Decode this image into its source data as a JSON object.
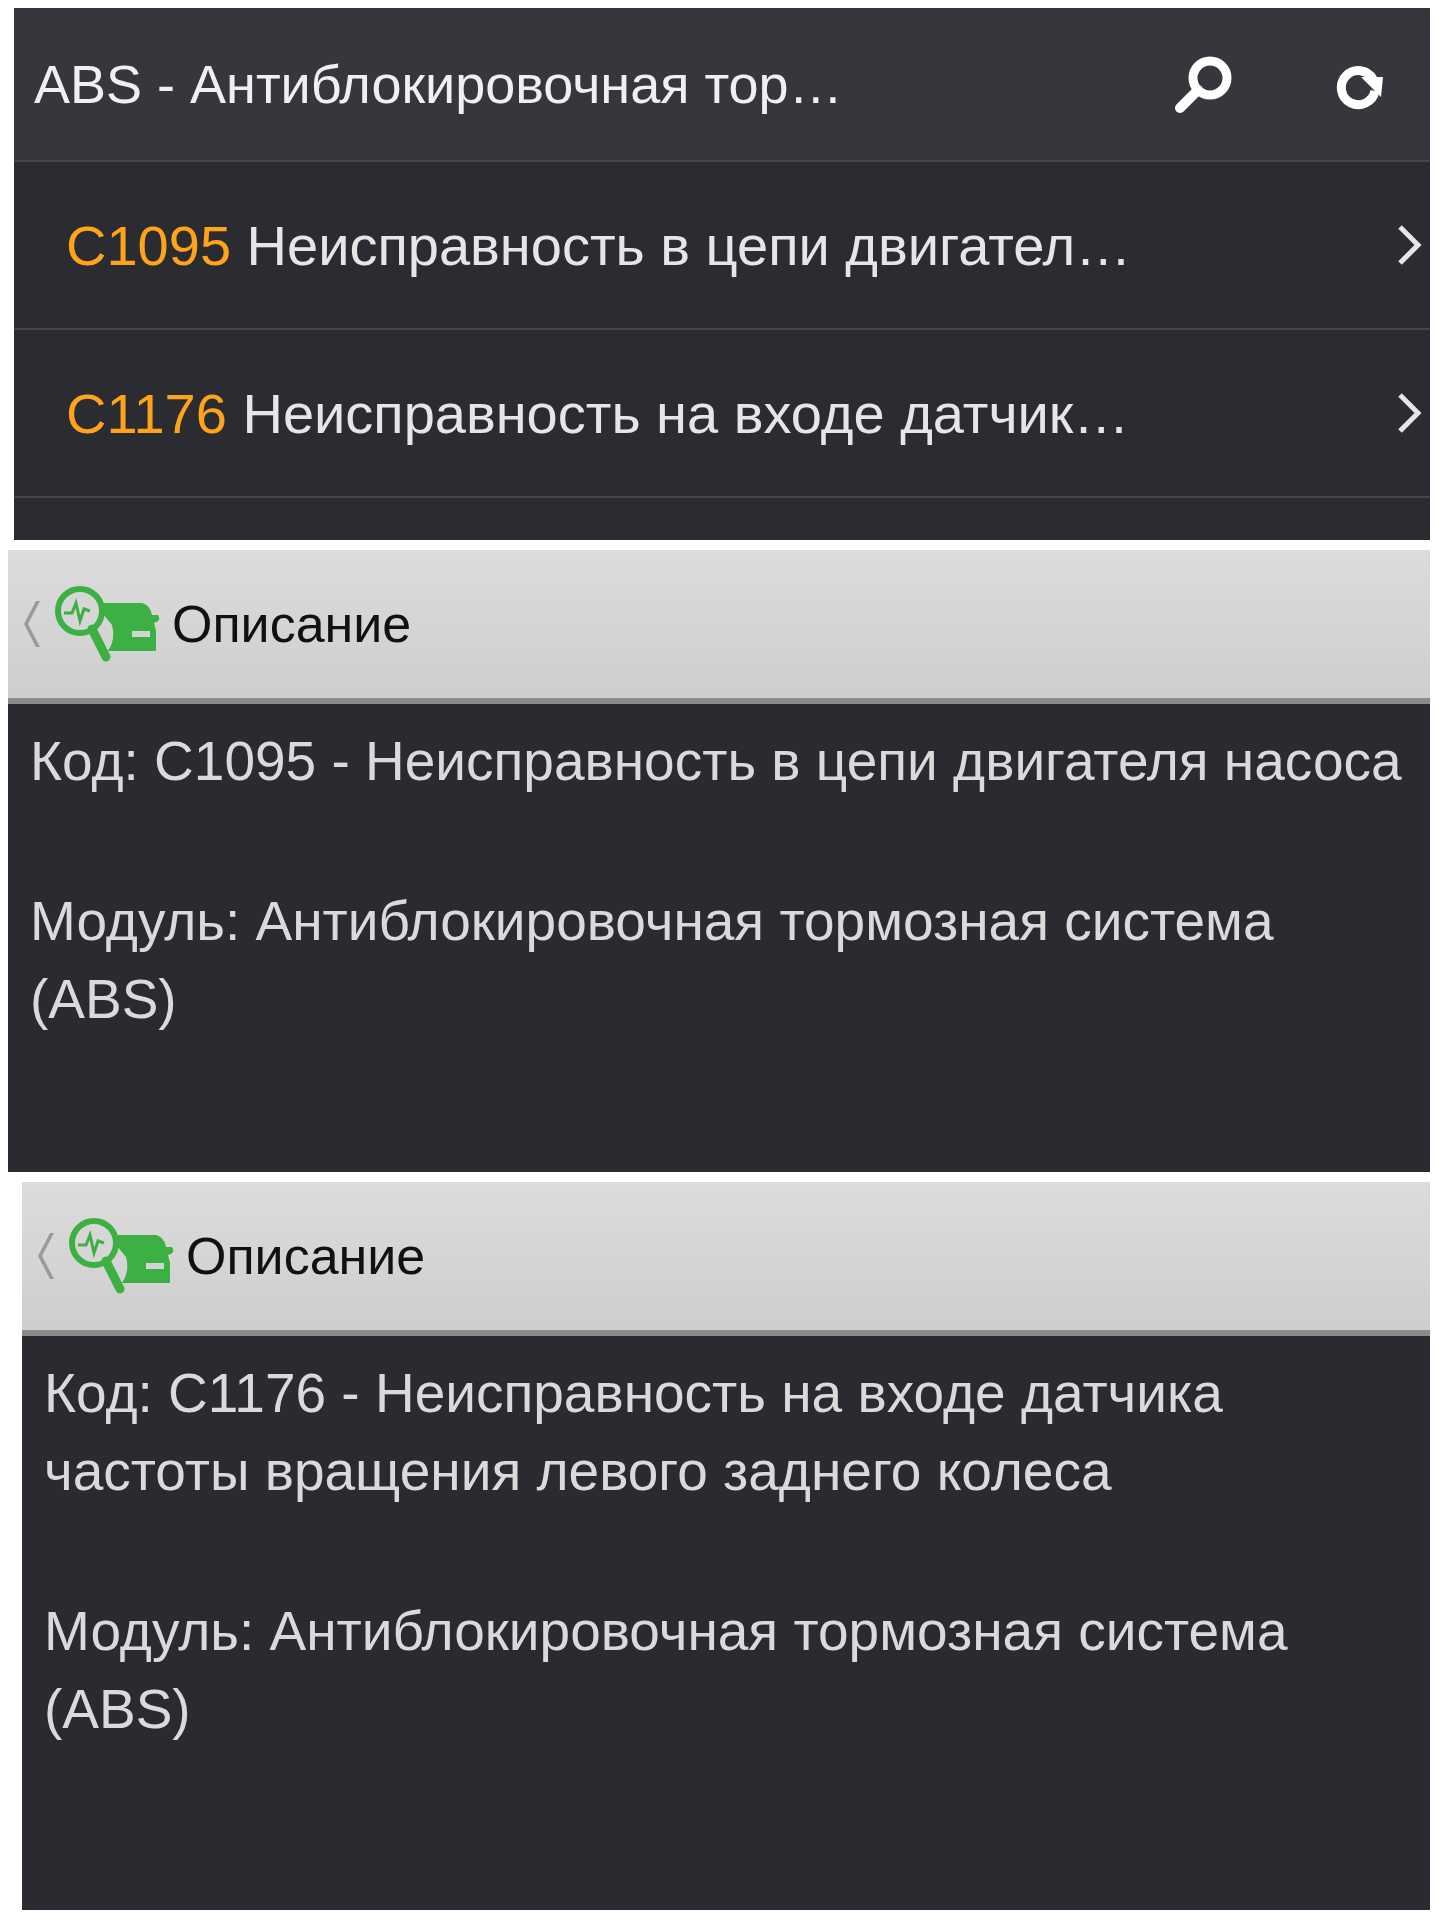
{
  "list_screen": {
    "title": "ABS - Антиблокировочная тор…",
    "items": [
      {
        "code": "C1095",
        "text": "Неисправность в цепи двигател…"
      },
      {
        "code": "C1176",
        "text": "Неисправность на входе датчик…"
      }
    ]
  },
  "detail_screens": [
    {
      "title": "Описание",
      "paragraphs": [
        "Код: C1095 - Неисправность в цепи двигателя насоса",
        "Модуль: Антиблокировочная тормозная система (ABS)"
      ]
    },
    {
      "title": "Описание",
      "paragraphs": [
        "Код: C1176 - Неисправность на входе датчика частоты вращения левого заднего колеса",
        "Модуль: Антиблокировочная тормозная система (ABS)"
      ]
    }
  ]
}
